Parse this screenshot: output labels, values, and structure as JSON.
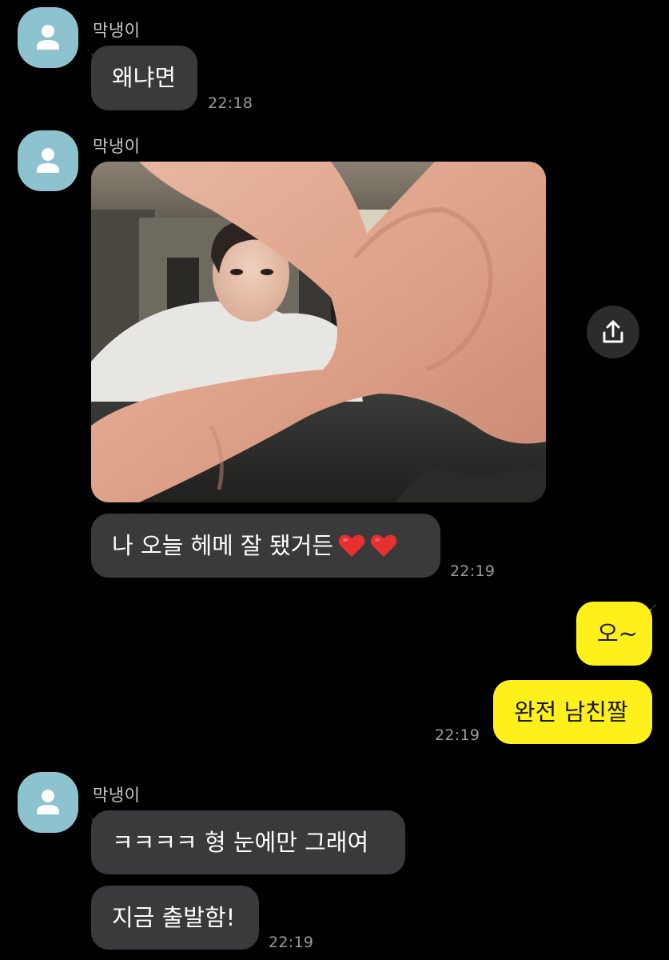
{
  "colors": {
    "background": "#000000",
    "incoming_bubble": "#3a3a3c",
    "outgoing_bubble": "#fef01b",
    "avatar": "#8cc3cf",
    "timestamp": "#9a9a9a",
    "sender_name": "#c9c9c9"
  },
  "messages": {
    "group1": {
      "sender": "막냉이",
      "avatar_icon": "person-icon",
      "bubble1": "왜냐면",
      "time": "22:18"
    },
    "group2": {
      "sender": "막냉이",
      "avatar_icon": "person-icon",
      "photo": "photo-attachment",
      "share_icon": "share-icon",
      "bubble1": "나 오늘 헤메 잘 됐거든",
      "bubble1_emoji": "heart-icon",
      "time": "22:19"
    },
    "group3": {
      "bubble1": "오~",
      "bubble2": "완전 남친짤",
      "time": "22:19"
    },
    "group4": {
      "sender": "막냉이",
      "avatar_icon": "person-icon",
      "bubble1": "ㅋㅋㅋㅋ 형 눈에만 그래여",
      "bubble2": "지금 출발함!",
      "time": "22:19"
    }
  }
}
